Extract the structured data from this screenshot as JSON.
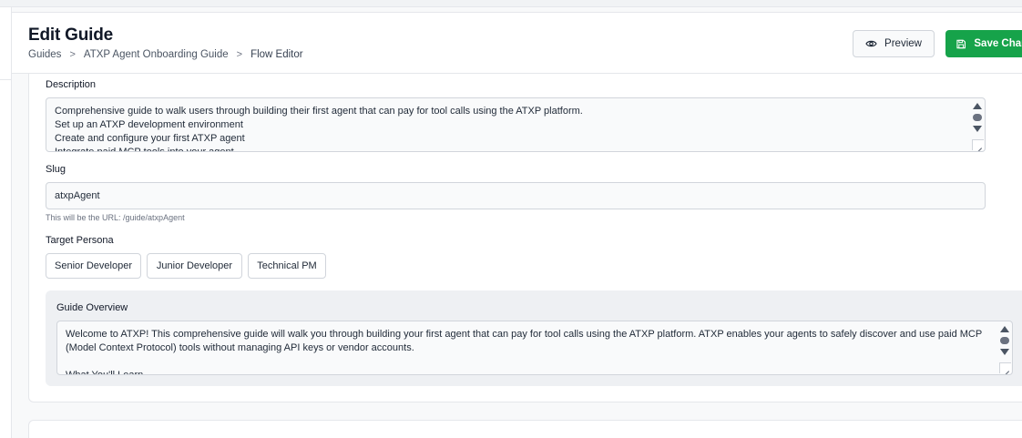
{
  "header": {
    "title": "Edit Guide",
    "breadcrumb": [
      "Guides",
      "ATXP Agent Onboarding Guide",
      "Flow Editor"
    ],
    "breadcrumb_separator": ">",
    "preview_label": "Preview",
    "save_label": "Save Changes"
  },
  "form": {
    "description": {
      "label": "Description",
      "value": "Comprehensive guide to walk users through building their first agent that can pay for tool calls using the ATXP platform.\nSet up an ATXP development environment\nCreate and configure your first ATXP agent\nIntegrate paid MCP tools into your agent"
    },
    "slug": {
      "label": "Slug",
      "value": "atxpAgent",
      "hint": "This will be the URL: /guide/atxpAgent"
    },
    "persona": {
      "label": "Target Persona",
      "options": [
        "Senior Developer",
        "Junior Developer",
        "Technical PM"
      ]
    },
    "overview": {
      "label": "Guide Overview",
      "value": "Welcome to ATXP! This comprehensive guide will walk you through building your first agent that can pay for tool calls using the ATXP platform. ATXP enables your agents to safely discover and use paid MCP (Model Context Protocol) tools without managing API keys or vendor accounts.\n\nWhat You'll Learn"
    }
  },
  "colors": {
    "accent": "#16a34a",
    "panel": "#eef0f3",
    "border": "#d1d5db"
  },
  "icons": {
    "preview": "eye-icon",
    "save": "save-icon",
    "separator": "chevron-right-icon"
  }
}
